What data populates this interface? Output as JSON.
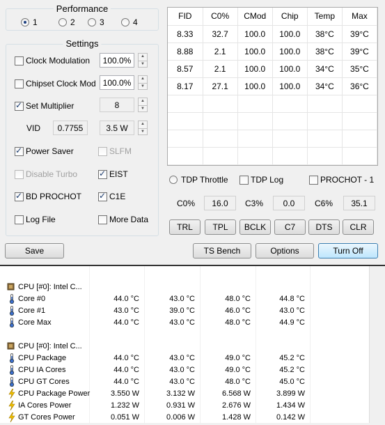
{
  "performance": {
    "title": "Performance",
    "profiles": [
      {
        "label": "1",
        "selected": true
      },
      {
        "label": "2",
        "selected": false
      },
      {
        "label": "3",
        "selected": false
      },
      {
        "label": "4",
        "selected": false
      }
    ]
  },
  "settings": {
    "title": "Settings",
    "clock_modulation": {
      "label": "Clock Modulation",
      "value": "100.0%",
      "checked": false
    },
    "chipset_clock_mod": {
      "label": "Chipset Clock Mod",
      "value": "100.0%",
      "checked": false
    },
    "set_multiplier": {
      "label": "Set Multiplier",
      "value": "8",
      "checked": true
    },
    "vid": {
      "label": "VID",
      "value": "0.7755",
      "power": "3.5 W"
    },
    "power_saver": {
      "label": "Power Saver",
      "checked": true
    },
    "slfm": {
      "label": "SLFM",
      "checked": false
    },
    "disable_turbo": {
      "label": "Disable Turbo",
      "checked": false
    },
    "eist": {
      "label": "EIST",
      "checked": true
    },
    "bd_prochot": {
      "label": "BD PROCHOT",
      "checked": true
    },
    "c1e": {
      "label": "C1E",
      "checked": true
    },
    "log_file": {
      "label": "Log File",
      "checked": false
    },
    "more_data": {
      "label": "More Data",
      "checked": false
    }
  },
  "grid": {
    "headers": [
      "FID",
      "C0%",
      "CMod",
      "Chip",
      "Temp",
      "Max"
    ],
    "rows": [
      [
        "8.33",
        "32.7",
        "100.0",
        "100.0",
        "38°C",
        "39°C"
      ],
      [
        "8.88",
        "2.1",
        "100.0",
        "100.0",
        "38°C",
        "39°C"
      ],
      [
        "8.57",
        "2.1",
        "100.0",
        "100.0",
        "34°C",
        "35°C"
      ],
      [
        "8.17",
        "27.1",
        "100.0",
        "100.0",
        "34°C",
        "36°C"
      ]
    ]
  },
  "options": {
    "tdp_throttle": "TDP Throttle",
    "tdp_log": "TDP Log",
    "prochot": "PROCHOT - 1"
  },
  "cstates": {
    "c0_label": "C0%",
    "c0_value": "16.0",
    "c3_label": "C3%",
    "c3_value": "0.0",
    "c6_label": "C6%",
    "c6_value": "35.1"
  },
  "tool_buttons": [
    "TRL",
    "TPL",
    "BCLK",
    "C7",
    "DTS",
    "CLR"
  ],
  "bottom_buttons": {
    "save": "Save",
    "ts_bench": "TS Bench",
    "options": "Options",
    "turn_off": "Turn Off"
  },
  "sensors": {
    "groups": [
      {
        "title": "CPU [#0]: Intel C...",
        "rows": [
          {
            "icon": "thermometer-icon",
            "name": "Core #0",
            "values": [
              "44.0 °C",
              "43.0 °C",
              "48.0 °C",
              "44.8 °C"
            ]
          },
          {
            "icon": "thermometer-icon",
            "name": "Core #1",
            "values": [
              "43.0 °C",
              "39.0 °C",
              "46.0 °C",
              "43.0 °C"
            ]
          },
          {
            "icon": "thermometer-icon",
            "name": "Core Max",
            "values": [
              "44.0 °C",
              "43.0 °C",
              "48.0 °C",
              "44.9 °C"
            ]
          }
        ]
      },
      {
        "title": "CPU [#0]: Intel C...",
        "rows": [
          {
            "icon": "thermometer-icon",
            "name": "CPU Package",
            "values": [
              "44.0 °C",
              "43.0 °C",
              "49.0 °C",
              "45.2 °C"
            ]
          },
          {
            "icon": "thermometer-icon",
            "name": "CPU IA Cores",
            "values": [
              "44.0 °C",
              "43.0 °C",
              "49.0 °C",
              "45.2 °C"
            ]
          },
          {
            "icon": "thermometer-icon",
            "name": "CPU GT Cores",
            "values": [
              "44.0 °C",
              "43.0 °C",
              "48.0 °C",
              "45.0 °C"
            ]
          },
          {
            "icon": "lightning-icon",
            "name": "CPU Package Power",
            "values": [
              "3.550 W",
              "3.132 W",
              "6.568 W",
              "3.899 W"
            ]
          },
          {
            "icon": "lightning-icon",
            "name": "IA Cores Power",
            "values": [
              "1.232 W",
              "0.931 W",
              "2.676 W",
              "1.434 W"
            ]
          },
          {
            "icon": "lightning-icon",
            "name": "GT Cores Power",
            "values": [
              "0.051 W",
              "0.006 W",
              "1.428 W",
              "0.142 W"
            ]
          }
        ]
      }
    ]
  },
  "colors": {
    "accent": "#1c3f7f",
    "thermometer": "#3b6fd0",
    "lightning": "#f0c000"
  }
}
